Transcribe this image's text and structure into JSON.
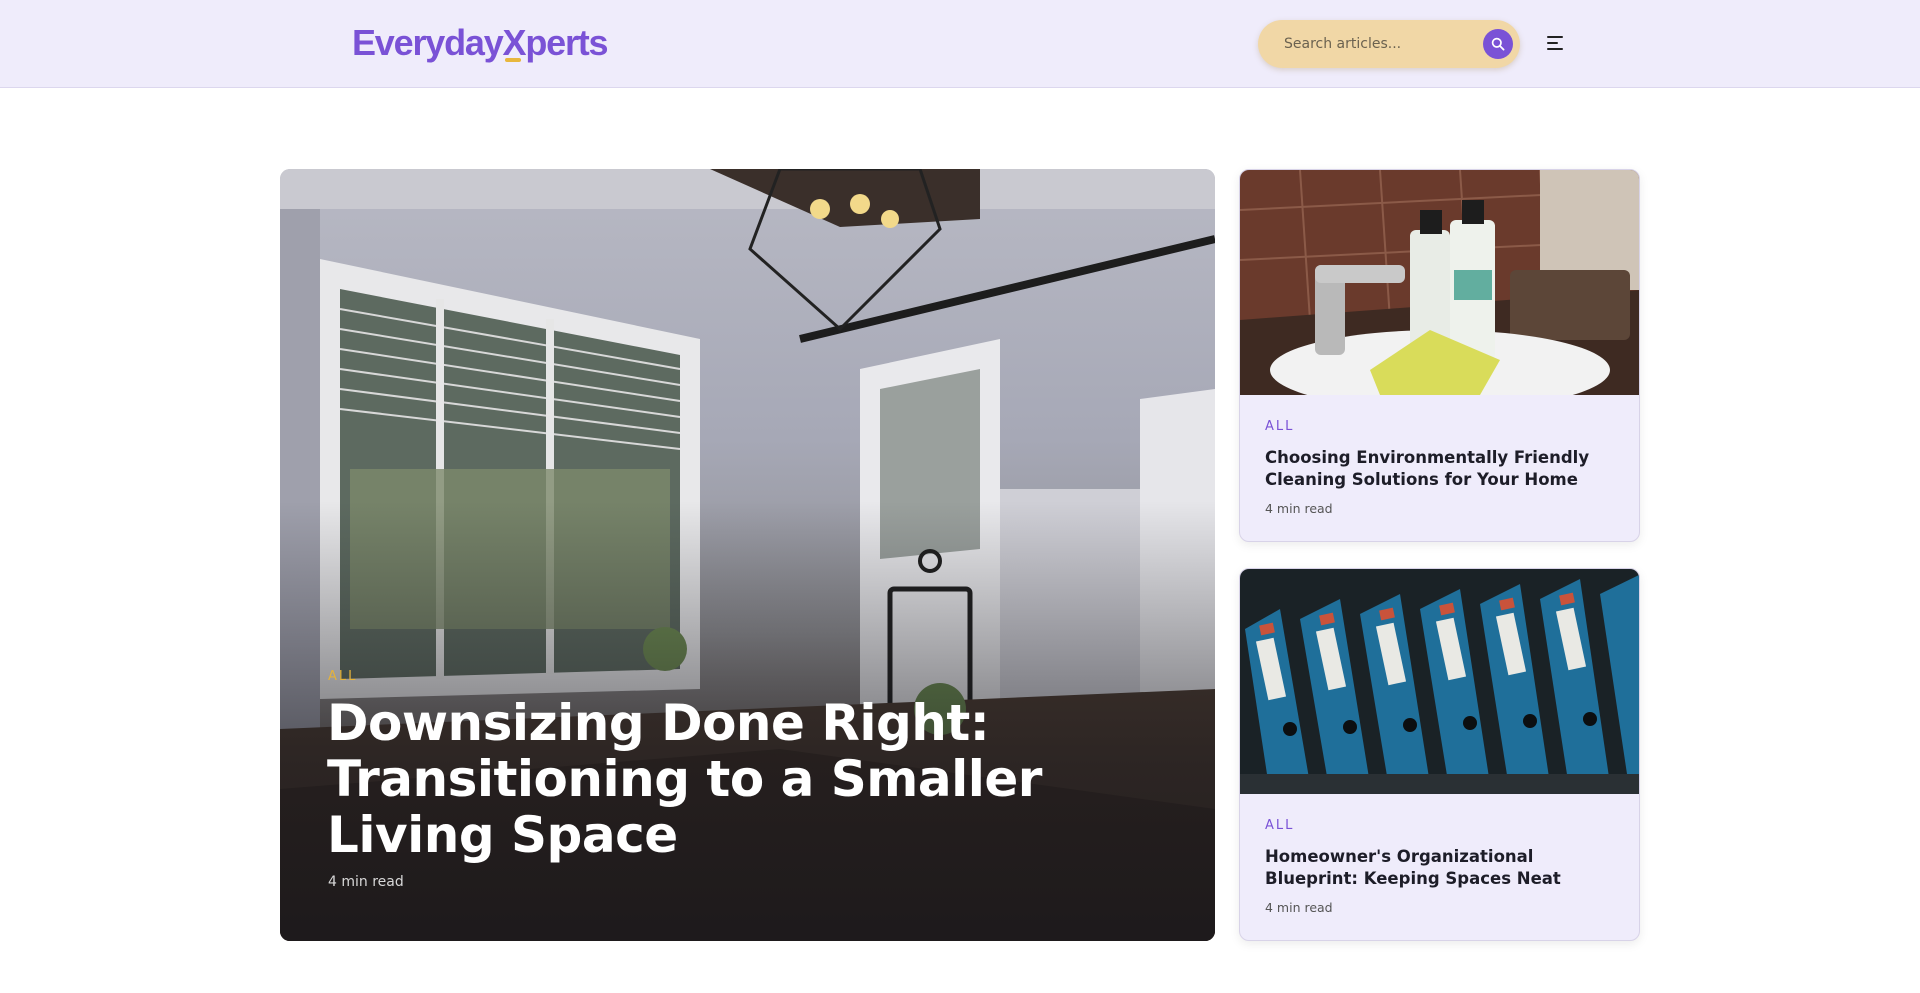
{
  "header": {
    "logo_part1": "Everyday",
    "logo_part2": "X",
    "logo_part3": "perts",
    "search_placeholder": "Search articles...",
    "search_icon": "search-icon",
    "menu_icon": "menu-icon"
  },
  "featured": {
    "category": "ALL",
    "title": "Downsizing Done Right: Transitioning to a Smaller Living Space",
    "read_time": "4 min read"
  },
  "articles": [
    {
      "category": "ALL",
      "title": "Choosing Environmentally Friendly Cleaning Solutions for Your Home",
      "read_time": "4 min read"
    },
    {
      "category": "ALL",
      "title": "Homeowner's Organizational Blueprint: Keeping Spaces Neat",
      "read_time": "4 min read"
    }
  ],
  "colors": {
    "brand": "#7a52d6",
    "accent": "#e8b73d",
    "header_bg": "#efecfb",
    "search_bg": "#f1d7a6"
  }
}
